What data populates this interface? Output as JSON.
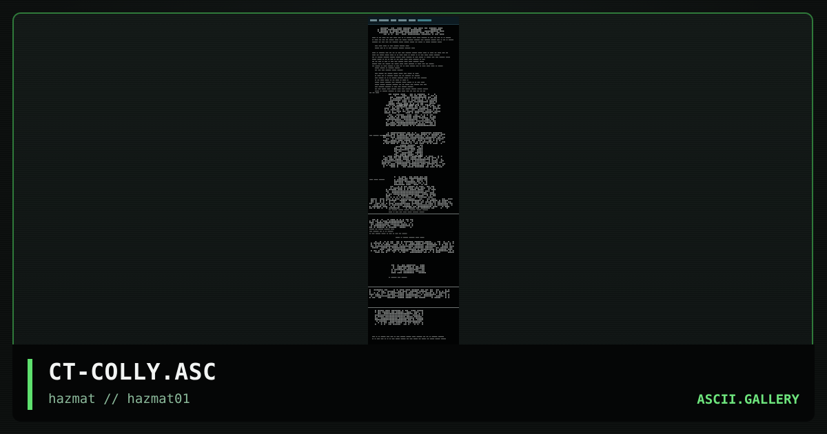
{
  "artwork": {
    "title": "CT-COLLY.ASC",
    "credit": "hazmat // hazmat01"
  },
  "site": {
    "brand": "ASCII.GALLERY"
  },
  "colors": {
    "accent": "#5ee06e",
    "frame_border": "#2f7a3a",
    "background": "#0b0e0d",
    "caption_background": "#050606",
    "subtitle": "#8bb99a",
    "title": "#f2f4f3"
  },
  "icons": {
    "preview": "ascii-art-thumbnail"
  }
}
